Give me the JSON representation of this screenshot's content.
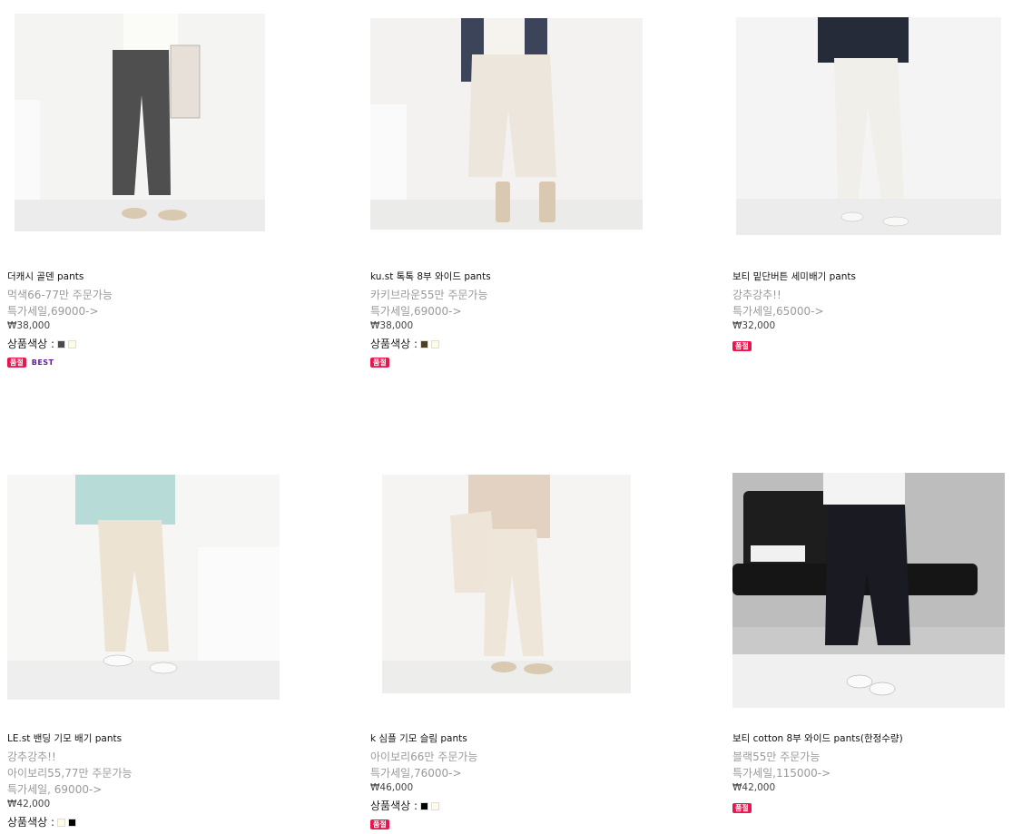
{
  "products": [
    {
      "name": "더캐시 골덴 pants",
      "lines": [
        "먹색66-77만 주문가능",
        "특가세일,69000->"
      ],
      "price": "₩38,000",
      "color_label": "상품색상 :",
      "swatches": [
        "#4a4a4a",
        "#fffbe6"
      ],
      "badges": {
        "soldout": "품절",
        "best": "BEST"
      }
    },
    {
      "name": "ku.st 톡톡 8부 와이드 pants",
      "lines": [
        "카키브라운55만 주문가능",
        "특가세일,69000->"
      ],
      "price": "₩38,000",
      "color_label": "상품색상 :",
      "swatches": [
        "#4a4026",
        "#fffbe6"
      ],
      "badges": {
        "soldout": "품절"
      }
    },
    {
      "name": "보티 밑단버튼 세미배기 pants",
      "lines": [
        "강추강추!!",
        "특가세일,65000->"
      ],
      "price": "₩32,000",
      "badges": {
        "soldout": "품절"
      }
    },
    {
      "name": "LE.st 밴딩 기모 배기 pants",
      "lines": [
        "강추강추!!",
        "아이보리55,77만 주문가능",
        "특가세일, 69000->"
      ],
      "price": "₩42,000",
      "color_label": "상품색상 :",
      "swatches": [
        "#fffbe6",
        "#000000"
      ]
    },
    {
      "name": "k 심플 기모 슬림 pants",
      "lines": [
        "아이보리66만 주문가능",
        "특가세일,76000->"
      ],
      "price": "₩46,000",
      "color_label": "상품색상 :",
      "swatches": [
        "#000000",
        "#fffbe6"
      ],
      "badges": {
        "soldout": "품절"
      }
    },
    {
      "name": "보티 cotton 8부 와이드 pants(한정수량)",
      "lines": [
        "블랙55만 주문가능",
        "특가세일,115000->"
      ],
      "price": "₩42,000",
      "badges": {
        "soldout": "품절"
      }
    }
  ]
}
